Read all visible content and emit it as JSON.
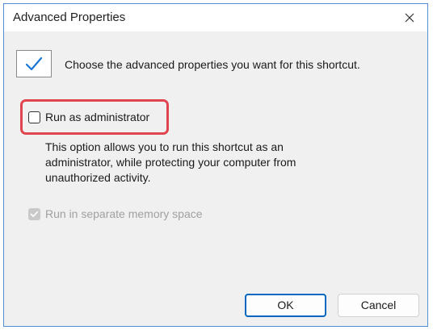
{
  "window": {
    "title": "Advanced Properties",
    "close_icon": "close-icon"
  },
  "shortcut_icon": "checkmark-icon",
  "intro_text": "Choose the advanced properties you want for this shortcut.",
  "options": {
    "run_as_admin": {
      "label": "Run as administrator",
      "checked": false,
      "enabled": true
    },
    "description": [
      "This option allows you to run this shortcut as an",
      "administrator, while protecting your computer from",
      "unauthorized activity."
    ],
    "separate_memory": {
      "label": "Run in separate memory space",
      "checked": true,
      "enabled": false
    }
  },
  "buttons": {
    "ok": "OK",
    "cancel": "Cancel"
  },
  "colors": {
    "accent": "#0067c0",
    "highlight": "#e0454f",
    "window_border": "#4f8fd6"
  }
}
